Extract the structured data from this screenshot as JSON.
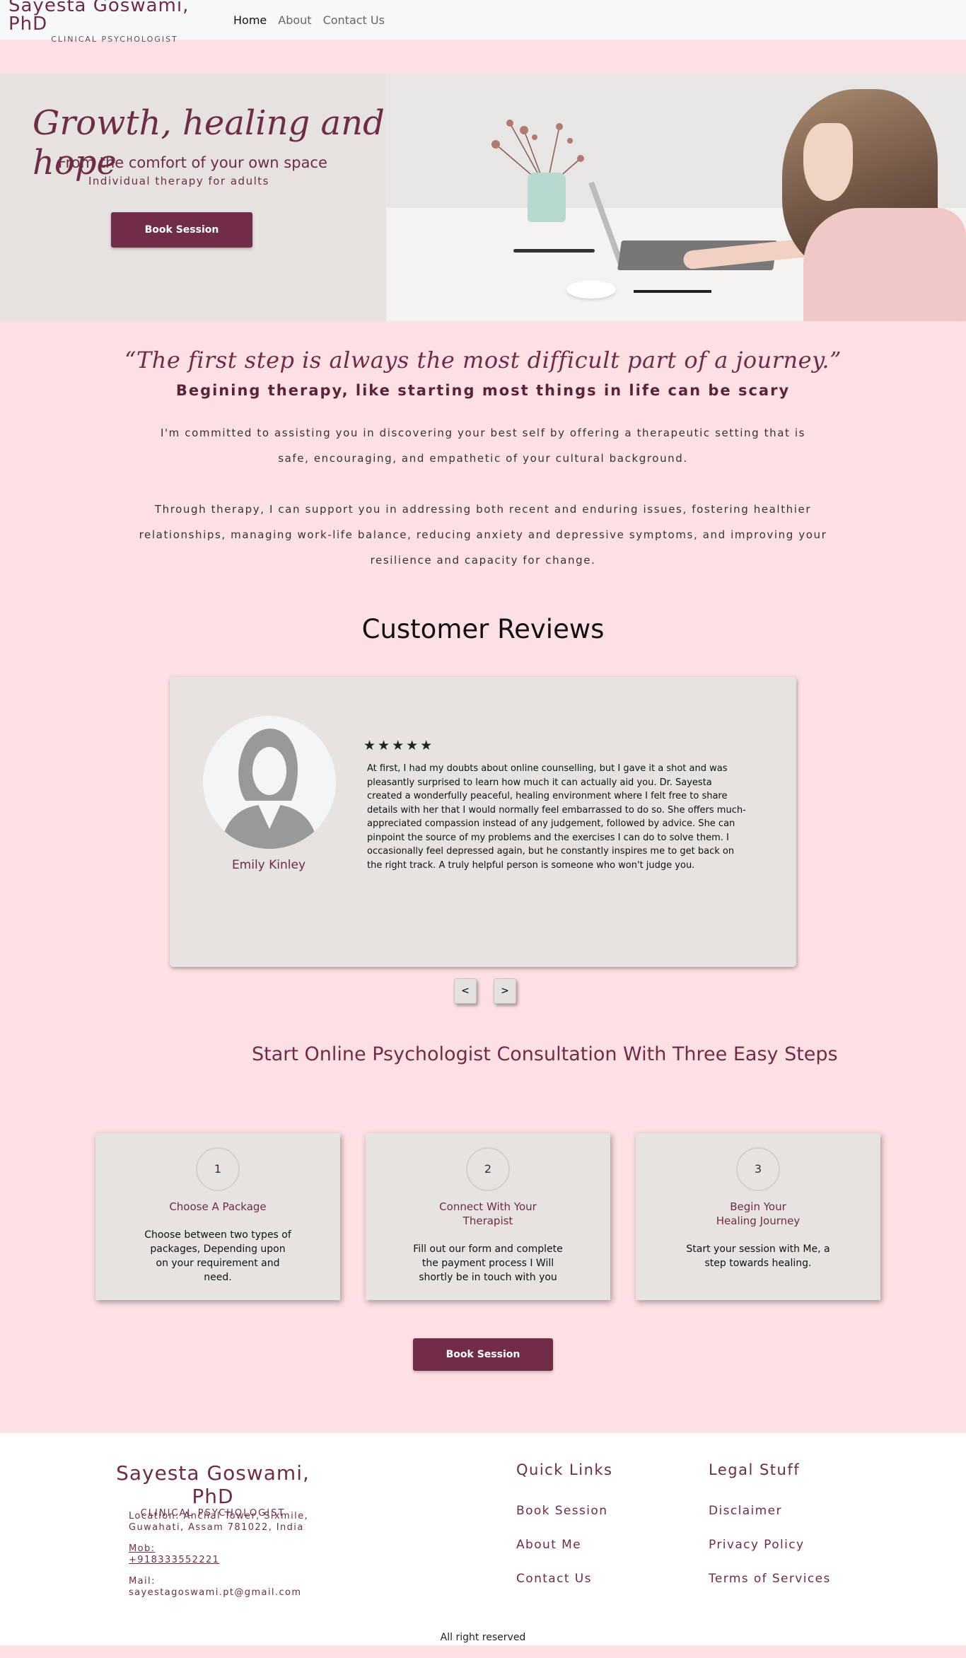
{
  "nav": {
    "brand_name": "Sayesta Goswami, PhD",
    "brand_sub": "CLINICAL PSYCHOLOGIST",
    "links": [
      "Home",
      "About",
      "Contact Us"
    ]
  },
  "hero": {
    "title": "Growth, healing and hope",
    "subtitle": "From the comfort of your own space",
    "subtitle2": "Individual therapy for adults",
    "button": "Book Session"
  },
  "intro": {
    "quote": "“The first step is always the most difficult part of a journey.”",
    "subtitle": "Begining therapy, like starting most things in life can be scary",
    "para1": "I'm committed to assisting you in discovering your best self by offering a therapeutic setting that is safe, encouraging, and empathetic of your cultural background.",
    "para2": "Through therapy, I can support you in addressing both recent and enduring issues, fostering healthier relationships, managing work-life balance, reducing anxiety and depressive symptoms, and improving your resilience and capacity for change."
  },
  "reviews": {
    "title": "Customer Reviews",
    "stars": "★★★★★",
    "reviewer": "Emily Kinley",
    "text": "At first, I had my doubts about online counselling, but I gave it a shot and was pleasantly surprised to learn how much it can actually aid you. Dr. Sayesta created a wonderfully peaceful, healing environment where I felt free to share details with her that I would normally feel embarrassed to do so. She offers much-appreciated compassion instead of any judgement, followed by advice. She can pinpoint the source of my problems and the exercises I can do to solve them. I occasionally feel depressed again, but he constantly inspires me to get back on the right track. A truly helpful person is someone who won't judge you.",
    "prev": "<",
    "next": ">"
  },
  "steps": {
    "title": "Start Online Psychologist Consultation With Three Easy Steps",
    "items": [
      {
        "num": "1",
        "title": "Choose A Package",
        "desc": "Choose between two types of packages, Depending upon on your requirement and need."
      },
      {
        "num": "2",
        "title": "Connect With Your Therapist",
        "desc": "Fill out our form and complete the payment process I Will shortly be in touch with you"
      },
      {
        "num": "3",
        "title": "Begin Your Healing Journey",
        "desc": "Start your session with Me, a step towards healing."
      }
    ],
    "button": "Book Session"
  },
  "footer": {
    "brand_name": "Sayesta Goswami, PhD",
    "brand_sub": "CLINICAL PSYCHOLOGIST",
    "location": "Location: Anchal Tower, Sixmile, Guwahati, Assam 781022, India",
    "mob_label": "Mob:",
    "mob": "+918333552221",
    "mail_label": "Mail:",
    "mail": "sayestagoswami.pt@gmail.com",
    "quick_title": "Quick Links",
    "quick_links": [
      "Book Session",
      "About Me",
      "Contact Us"
    ],
    "legal_title": "Legal Stuff",
    "legal_links": [
      "Disclaimer",
      "Privacy Policy",
      "Terms of Services"
    ],
    "copyright": "All right reserved"
  },
  "colors": {
    "accent": "#712d47",
    "background": "#fde0e3",
    "card": "#e6e3e1"
  }
}
